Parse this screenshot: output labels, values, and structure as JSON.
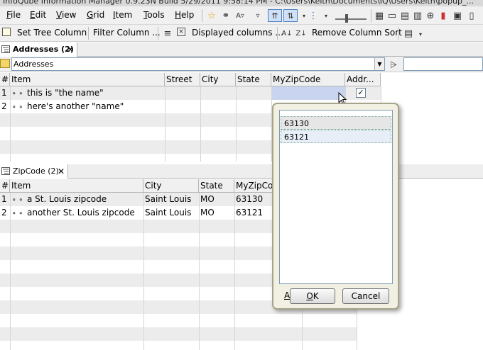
{
  "window": {
    "title": "InfoQube Information Manager 0.9.23N  Build 5/29/2011  9:58:14 PM  -  C:\\Users\\Keith\\Documents\\IQ\\Users\\Keith\\popup_..."
  },
  "menu": [
    {
      "label": "File",
      "key": "F",
      "rest": "ile"
    },
    {
      "label": "Edit",
      "key": "E",
      "rest": "dit"
    },
    {
      "label": "View",
      "key": "V",
      "rest": "iew"
    },
    {
      "label": "Grid",
      "key": "G",
      "rest": "rid"
    },
    {
      "label": "Item",
      "key": "I",
      "rest": "tem"
    },
    {
      "label": "Tools",
      "key": "T",
      "rest": "ools"
    },
    {
      "label": "Help",
      "key": "H",
      "rest": "elp"
    }
  ],
  "toolbar2": {
    "set_tree_column": "Set Tree Column",
    "filter_column": "Filter Column ...",
    "displayed_columns": "Displayed columns ...",
    "remove_column_sort": "Remove Column Sort"
  },
  "addresses": {
    "tab_label": "Addresses (2)",
    "filter_value": "Addresses",
    "columns": [
      "#",
      "Item",
      "Street",
      "City",
      "State",
      "MyZipCode",
      "Addr..."
    ],
    "rows": [
      {
        "num": "1",
        "item": "this is \"the name\"",
        "street": "",
        "city": "",
        "state": "",
        "zip": "",
        "checked": true
      },
      {
        "num": "2",
        "item": "here's another \"name\"",
        "street": "",
        "city": "",
        "state": "",
        "zip": "",
        "checked": false
      }
    ]
  },
  "zipcode": {
    "tab_label": "ZipCode (2)",
    "columns": [
      "#",
      "Item",
      "City",
      "State",
      "MyZipCode"
    ],
    "rows": [
      {
        "num": "1",
        "item": "a St. Louis zipcode",
        "city": "Saint Louis",
        "state": "MO",
        "zip": "63130"
      },
      {
        "num": "2",
        "item": "another St. Louis zipcode",
        "city": "Saint Louis",
        "state": "MO",
        "zip": "63121"
      }
    ]
  },
  "popup": {
    "options": [
      "63130",
      "63121"
    ],
    "ok_key": "O",
    "ok_rest": "K",
    "cancel_label": "Cancel",
    "hidden_left_label": "A"
  },
  "colors": {
    "stripe": "#ececec",
    "selection": "#c8d4f0",
    "popup_bg": "#f2f0e2"
  }
}
